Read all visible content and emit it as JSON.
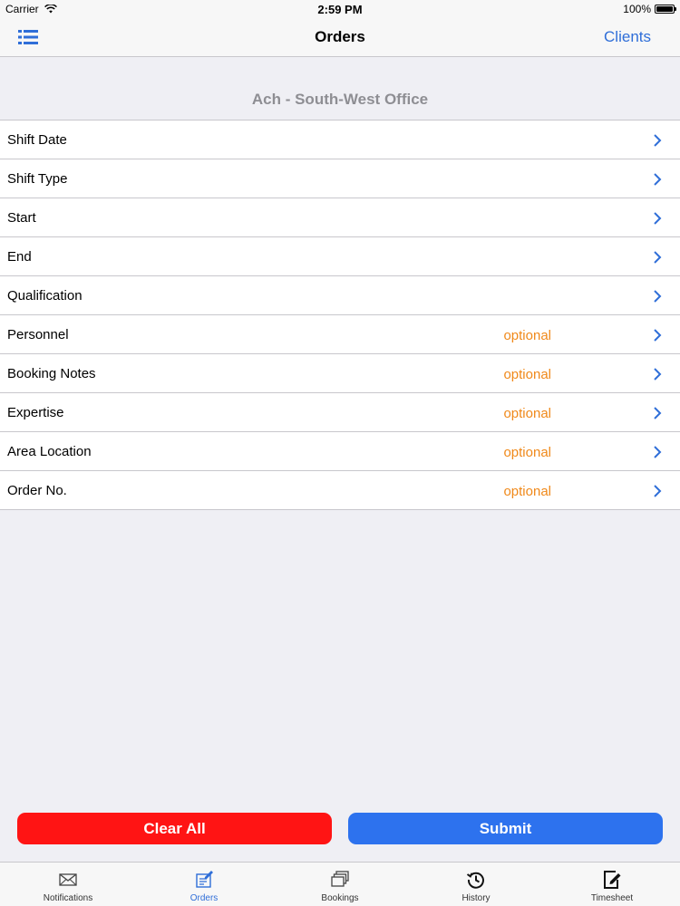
{
  "status_bar": {
    "carrier": "Carrier",
    "time": "2:59 PM",
    "battery": "100%",
    "battery_level": 1.0
  },
  "navbar": {
    "menu_icon": "list-icon",
    "title": "Orders",
    "right_label": "Clients"
  },
  "section": {
    "title": "Ach - South-West Office"
  },
  "rows": [
    {
      "label": "Shift Date",
      "hint": ""
    },
    {
      "label": "Shift Type",
      "hint": ""
    },
    {
      "label": "Start",
      "hint": ""
    },
    {
      "label": "End",
      "hint": ""
    },
    {
      "label": "Qualification",
      "hint": ""
    },
    {
      "label": "Personnel",
      "hint": "optional"
    },
    {
      "label": "Booking Notes",
      "hint": "optional"
    },
    {
      "label": "Expertise",
      "hint": "optional"
    },
    {
      "label": "Area Location",
      "hint": "optional"
    },
    {
      "label": "Order No.",
      "hint": "optional"
    }
  ],
  "buttons": {
    "clear_label": "Clear All",
    "submit_label": "Submit"
  },
  "tabs": [
    {
      "label": "Notifications",
      "icon": "envelope-icon",
      "active": false
    },
    {
      "label": "Orders",
      "icon": "order-form-icon",
      "active": true
    },
    {
      "label": "Bookings",
      "icon": "stacked-cards-icon",
      "active": false
    },
    {
      "label": "History",
      "icon": "history-clock-icon",
      "active": false
    },
    {
      "label": "Timesheet",
      "icon": "edit-sheet-icon",
      "active": false
    }
  ],
  "colors": {
    "accent": "#2f6ed8",
    "optional_hint": "#f0891a",
    "clear_button": "#ff1414",
    "submit_button": "#2d72ee",
    "background": "#efeff4"
  }
}
